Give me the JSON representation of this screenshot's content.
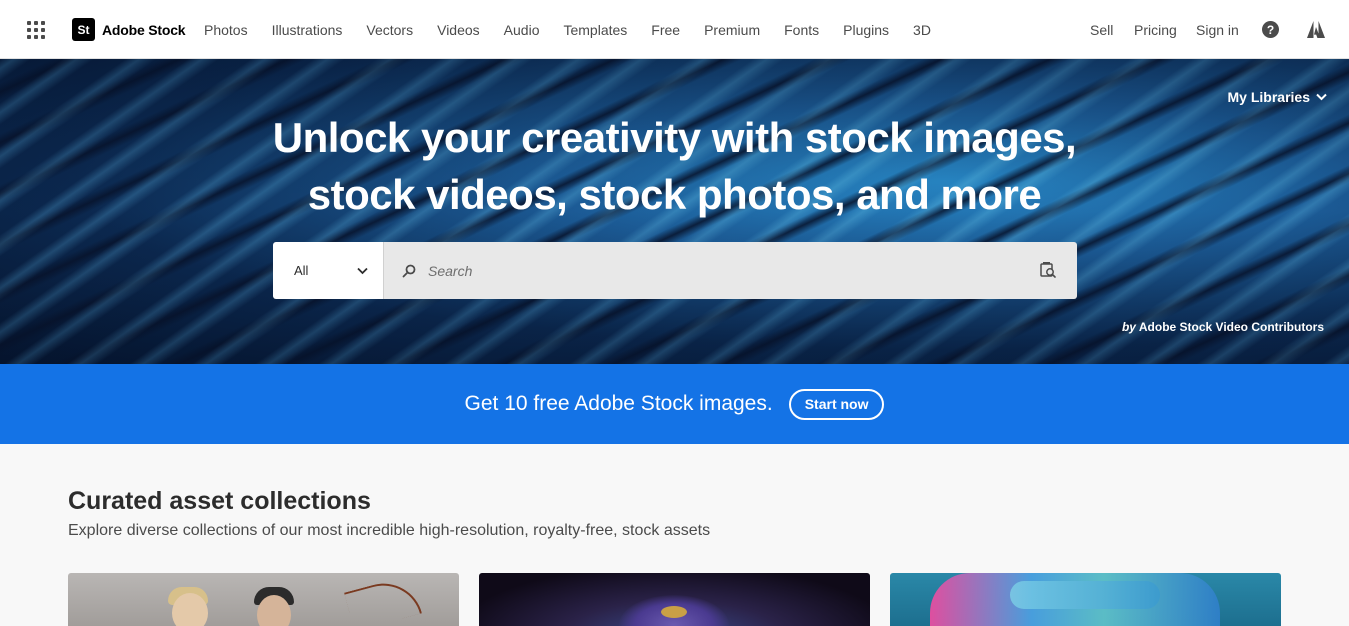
{
  "header": {
    "logo_mark": "St",
    "logo_text": "Adobe Stock",
    "nav": [
      "Photos",
      "Illustrations",
      "Vectors",
      "Videos",
      "Audio",
      "Templates",
      "Free",
      "Premium",
      "Fonts",
      "Plugins",
      "3D"
    ],
    "right_links": {
      "sell": "Sell",
      "pricing": "Pricing",
      "signin": "Sign in"
    },
    "help_glyph": "?",
    "icons": {
      "apps": "grid-icon",
      "help": "help-icon",
      "adobe": "adobe-logo-icon"
    }
  },
  "hero": {
    "my_libraries": "My Libraries",
    "title_line1": "Unlock your creativity with stock images,",
    "title_line2": "stock videos, stock photos, and more",
    "search": {
      "category": "All",
      "placeholder": "Search"
    },
    "credit_by": "by",
    "credit_name": "Adobe Stock Video Contributors"
  },
  "promo": {
    "text": "Get 10 free Adobe Stock images.",
    "button": "Start now"
  },
  "curated": {
    "title": "Curated asset collections",
    "subtitle": "Explore diverse collections of our most incredible high-resolution, royalty-free, stock assets"
  },
  "colors": {
    "promo_blue": "#1473e6",
    "text_dark": "#2c2c2c"
  }
}
